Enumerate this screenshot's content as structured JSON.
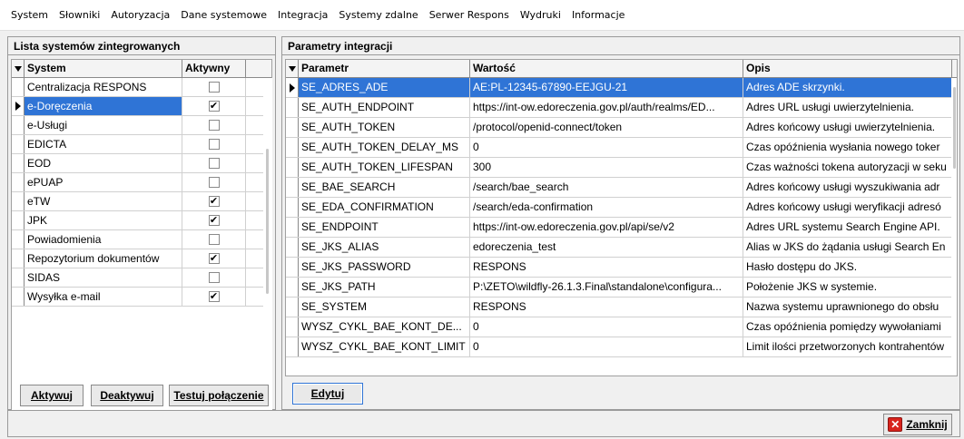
{
  "menu": [
    "System",
    "Słowniki",
    "Autoryzacja",
    "Dane systemowe",
    "Integracja",
    "Systemy zdalne",
    "Serwer Respons",
    "Wydruki",
    "Informacje"
  ],
  "left_panel": {
    "title": "Lista systemów zintegrowanych",
    "columns": {
      "system": "System",
      "active": "Aktywny"
    },
    "rows": [
      {
        "name": "Centralizacja RESPONS",
        "active": false
      },
      {
        "name": "e-Doręczenia",
        "active": true,
        "selected": true
      },
      {
        "name": "e-Usługi",
        "active": false
      },
      {
        "name": "EDICTA",
        "active": false
      },
      {
        "name": "EOD",
        "active": false
      },
      {
        "name": "ePUAP",
        "active": false
      },
      {
        "name": "eTW",
        "active": true
      },
      {
        "name": "JPK",
        "active": true
      },
      {
        "name": "Powiadomienia",
        "active": false
      },
      {
        "name": "Repozytorium dokumentów",
        "active": true
      },
      {
        "name": "SIDAS",
        "active": false
      },
      {
        "name": "Wysyłka e-mail",
        "active": true
      }
    ],
    "buttons": {
      "activate": "Aktywuj",
      "deactivate": "Deaktywuj",
      "test": "Testuj połączenie"
    }
  },
  "right_panel": {
    "title": "Parametry integracji",
    "columns": {
      "param": "Parametr",
      "value": "Wartość",
      "desc": "Opis"
    },
    "rows": [
      {
        "param": "SE_ADRES_ADE",
        "value": "AE:PL-12345-67890-EEJGU-21",
        "desc": "Adres ADE skrzynki.",
        "selected": true
      },
      {
        "param": "SE_AUTH_ENDPOINT",
        "value": "https://int-ow.edoreczenia.gov.pl/auth/realms/ED...",
        "desc": "Adres URL usługi uwierzytelnienia."
      },
      {
        "param": "SE_AUTH_TOKEN",
        "value": "/protocol/openid-connect/token",
        "desc": "Adres końcowy usługi uwierzytelnienia."
      },
      {
        "param": "SE_AUTH_TOKEN_DELAY_MS",
        "value": "0",
        "desc": "Czas opóźnienia wysłania nowego toker"
      },
      {
        "param": "SE_AUTH_TOKEN_LIFESPAN",
        "value": "300",
        "desc": "Czas ważności tokena autoryzacji w seku"
      },
      {
        "param": "SE_BAE_SEARCH",
        "value": "/search/bae_search",
        "desc": "Adres końcowy usługi wyszukiwania adr"
      },
      {
        "param": "SE_EDA_CONFIRMATION",
        "value": "/search/eda-confirmation",
        "desc": "Adres końcowy usługi weryfikacji adresó"
      },
      {
        "param": "SE_ENDPOINT",
        "value": "https://int-ow.edoreczenia.gov.pl/api/se/v2",
        "desc": "Adres URL systemu Search Engine API."
      },
      {
        "param": "SE_JKS_ALIAS",
        "value": "edoreczenia_test",
        "desc": "Alias w JKS do żądania usługi Search En"
      },
      {
        "param": "SE_JKS_PASSWORD",
        "value": "RESPONS",
        "desc": "Hasło dostępu do JKS."
      },
      {
        "param": "SE_JKS_PATH",
        "value": "P:\\ZETO\\wildfly-26.1.3.Final\\standalone\\configura...",
        "desc": "Położenie JKS w systemie."
      },
      {
        "param": "SE_SYSTEM",
        "value": "RESPONS",
        "desc": "Nazwa systemu uprawnionego do obsłu"
      },
      {
        "param": "WYSZ_CYKL_BAE_KONT_DE...",
        "value": "0",
        "desc": "Czas opóźnienia pomiędzy wywołaniami"
      },
      {
        "param": "WYSZ_CYKL_BAE_KONT_LIMIT",
        "value": "0",
        "desc": "Limit ilości przetworzonych kontrahentów"
      }
    ],
    "buttons": {
      "edit": "Edytuj"
    }
  },
  "footer": {
    "close": "Zamknij"
  },
  "colors": {
    "selection": "#2f74d6",
    "close_icon": "#d8231c"
  }
}
